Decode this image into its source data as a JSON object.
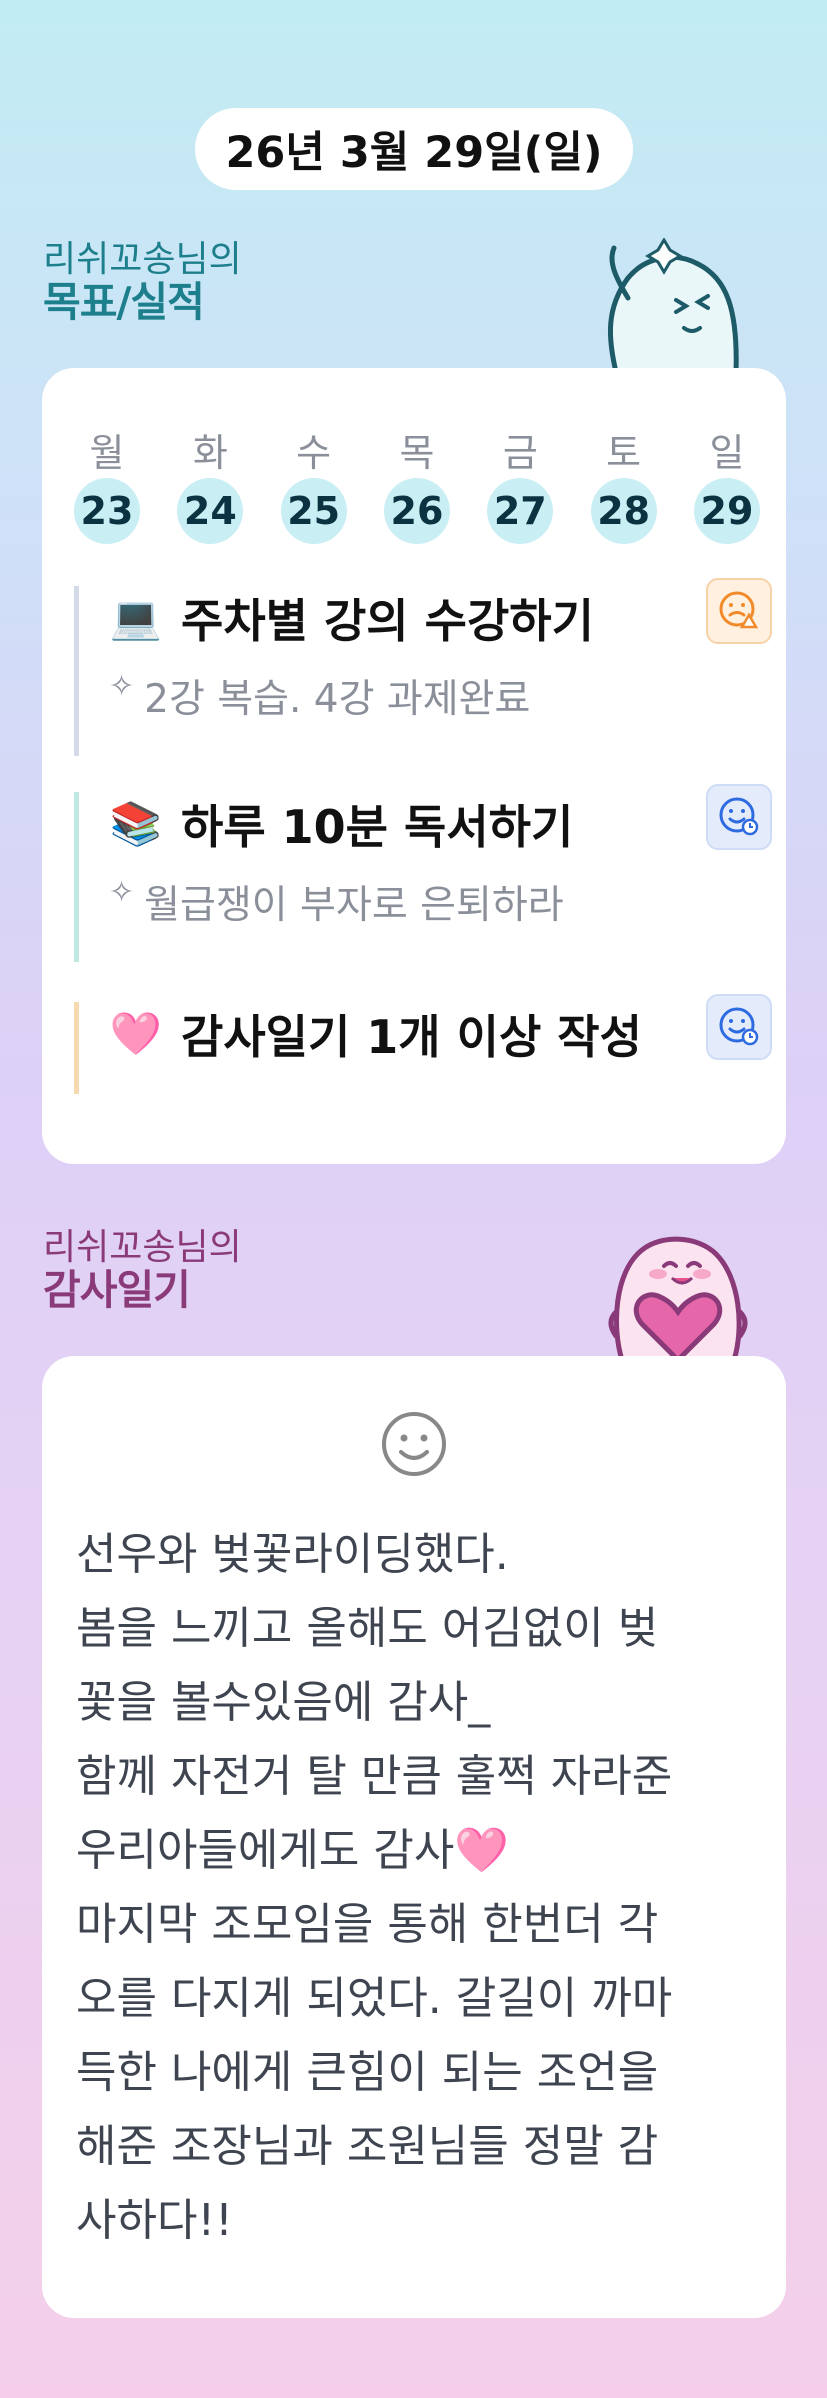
{
  "header": {
    "date": "26년 3월 29일(일)"
  },
  "goals_section": {
    "subtitle": "리쉬꼬송님의",
    "title": "목표/실적"
  },
  "week": [
    {
      "label": "월",
      "num": "23"
    },
    {
      "label": "화",
      "num": "24"
    },
    {
      "label": "수",
      "num": "25"
    },
    {
      "label": "목",
      "num": "26"
    },
    {
      "label": "금",
      "num": "27"
    },
    {
      "label": "토",
      "num": "28"
    },
    {
      "label": "일",
      "num": "29"
    }
  ],
  "goals": [
    {
      "emoji": "💻",
      "title": "주차별 강의 수강하기",
      "note": "2강 복습. 4강 과제완료",
      "status_icon": "smiley-warning-icon"
    },
    {
      "emoji": "📚",
      "title": "하루 10분 독서하기",
      "note": "월급쟁이 부자로 은퇴하라",
      "status_icon": "smiley-clock-icon"
    },
    {
      "emoji": "🩷",
      "title": "감사일기 1개 이상 작성",
      "status_icon": "smiley-clock-icon"
    }
  ],
  "diary_section": {
    "subtitle": "리쉬꼬송님의",
    "title": "감사일기"
  },
  "diary": {
    "mood_icon": "smiley-icon",
    "text": "선우와 벚꽃라이딩했다.\n봄을 느끼고 올해도 어김없이 벚\n꽃을 볼수있음에 감사_\n함께 자전거 탈 만큼 훌쩍 자라준\n우리아들에게도 감사🩷\n마지막 조모임을 통해 한번더 각\n오를 다지게 되었다. 갈길이 까마\n득한 나에게 큰힘이 되는 조언을\n해준 조장님과 조원님들 정말 감\n사하다!!"
  },
  "colors": {
    "teal": "#1e7f8c",
    "purple": "#8a3a78",
    "day_circle": "#c9eff5"
  }
}
